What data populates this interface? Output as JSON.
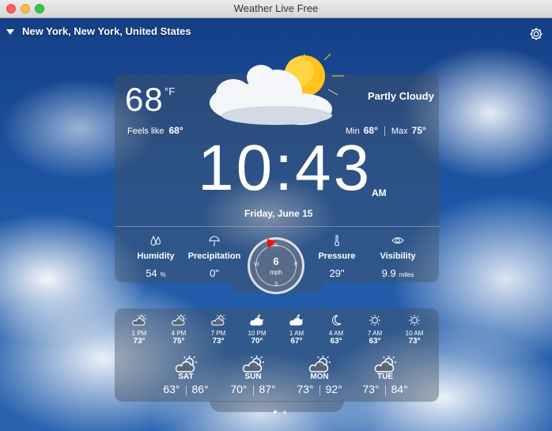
{
  "window": {
    "title": "Weather Live Free"
  },
  "location": {
    "name": "New York, New York, United States"
  },
  "current": {
    "temp": "68",
    "unit": "°F",
    "condition": "Partly Cloudy",
    "feels_like_label": "Feels like",
    "feels_like": "68°",
    "min_label": "Min",
    "min": "68°",
    "max_label": "Max",
    "max": "75°",
    "time": "10:43",
    "ampm": "AM",
    "date": "Friday, June 15"
  },
  "stats": {
    "humidity": {
      "label": "Humidity",
      "value": "54",
      "unit": "%"
    },
    "precipitation": {
      "label": "Precipitation",
      "value": "0\""
    },
    "wind": {
      "speed": "6",
      "unit": "mph",
      "n": "N",
      "e": "E",
      "s": "S",
      "w": "W"
    },
    "pressure": {
      "label": "Pressure",
      "value": "29\""
    },
    "visibility": {
      "label": "Visibility",
      "value": "9.9",
      "unit": "miles"
    }
  },
  "hourly": [
    {
      "time": "1 PM",
      "temp": "73°",
      "icon": "partly-cloudy-icon"
    },
    {
      "time": "4 PM",
      "temp": "75°",
      "icon": "partly-cloudy-icon"
    },
    {
      "time": "7 PM",
      "temp": "73°",
      "icon": "partly-cloudy-icon"
    },
    {
      "time": "10 PM",
      "temp": "70°",
      "icon": "cloudy-night-icon"
    },
    {
      "time": "1 AM",
      "temp": "67°",
      "icon": "cloudy-night-icon"
    },
    {
      "time": "4 AM",
      "temp": "63°",
      "icon": "moon-icon"
    },
    {
      "time": "7 AM",
      "temp": "63°",
      "icon": "sun-icon"
    },
    {
      "time": "10 AM",
      "temp": "73°",
      "icon": "sun-icon"
    }
  ],
  "daily": [
    {
      "day": "SAT",
      "low": "63°",
      "high": "86°",
      "icon": "partly-cloudy-icon"
    },
    {
      "day": "SUN",
      "low": "70°",
      "high": "87°",
      "icon": "partly-cloudy-icon"
    },
    {
      "day": "MON",
      "low": "73°",
      "high": "92°",
      "icon": "partly-cloudy-icon"
    },
    {
      "day": "TUE",
      "low": "73°",
      "high": "84°",
      "icon": "partly-cloudy-icon"
    }
  ],
  "pager": {
    "pages": 2,
    "current": 1
  },
  "colors": {
    "accent_red": "#e11111",
    "sun": "#ffcc00"
  }
}
